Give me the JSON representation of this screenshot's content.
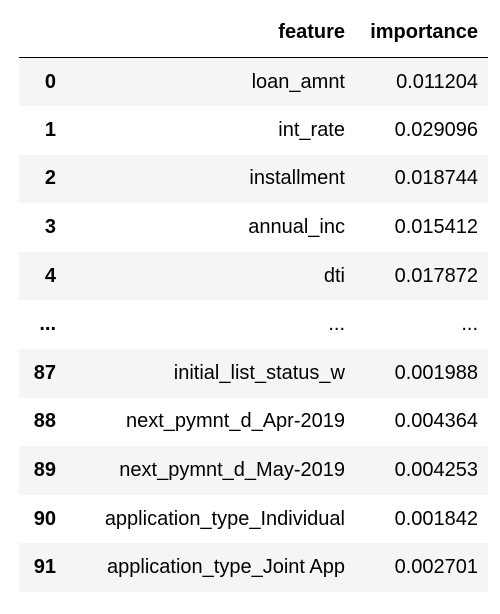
{
  "table": {
    "columns": [
      "",
      "feature",
      "importance"
    ],
    "rows": [
      {
        "index": "0",
        "feature": "loan_amnt",
        "importance": "0.011204"
      },
      {
        "index": "1",
        "feature": "int_rate",
        "importance": "0.029096"
      },
      {
        "index": "2",
        "feature": "installment",
        "importance": "0.018744"
      },
      {
        "index": "3",
        "feature": "annual_inc",
        "importance": "0.015412"
      },
      {
        "index": "4",
        "feature": "dti",
        "importance": "0.017872"
      },
      {
        "index": "...",
        "feature": "...",
        "importance": "..."
      },
      {
        "index": "87",
        "feature": "initial_list_status_w",
        "importance": "0.001988"
      },
      {
        "index": "88",
        "feature": "next_pymnt_d_Apr-2019",
        "importance": "0.004364"
      },
      {
        "index": "89",
        "feature": "next_pymnt_d_May-2019",
        "importance": "0.004253"
      },
      {
        "index": "90",
        "feature": "application_type_Individual",
        "importance": "0.001842"
      },
      {
        "index": "91",
        "feature": "application_type_Joint App",
        "importance": "0.002701"
      }
    ]
  }
}
